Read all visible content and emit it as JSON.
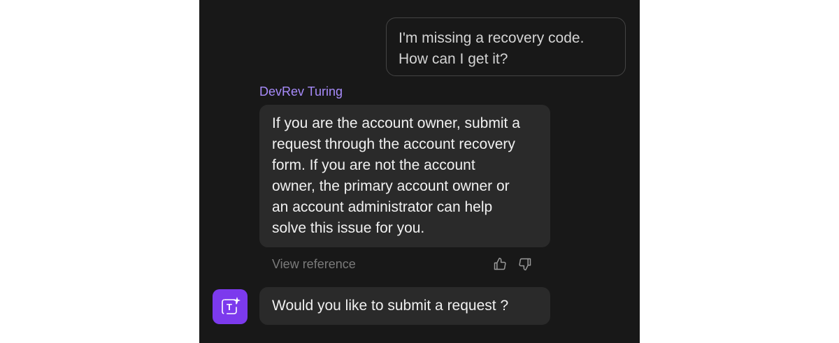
{
  "chat": {
    "user_message": {
      "lines": [
        "I'm missing a recovery code.",
        "How can I get it?"
      ]
    },
    "bot_name": "DevRev Turing",
    "bot_reply": {
      "lines": [
        "If you are the account owner, submit a",
        "request through the account recovery",
        "form. If you are not the account",
        "owner, the primary account owner or",
        "an account administrator can help",
        "solve this issue for you."
      ]
    },
    "view_reference_label": "View reference",
    "feedback": {
      "thumbs_up_icon": "thumbs-up-icon",
      "thumbs_down_icon": "thumbs-down-icon"
    },
    "avatar": {
      "letter": "T",
      "icon": "sparkle-icon",
      "color": "#7c3aed"
    },
    "followup_message": "Would you like to submit a request ?"
  },
  "colors": {
    "panel_bg": "#181818",
    "bubble_bg": "#2a2a2a",
    "accent": "#a78bfa",
    "muted": "#7a7a7a"
  }
}
